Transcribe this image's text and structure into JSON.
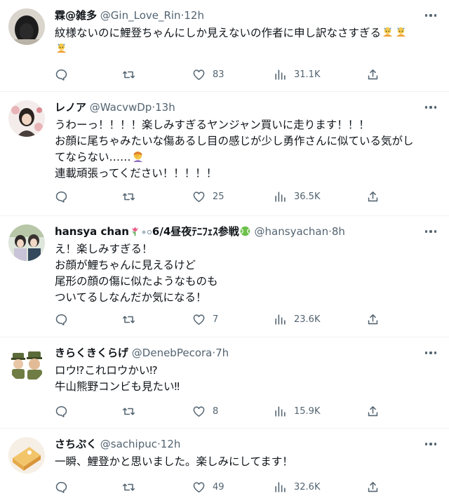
{
  "tweets": [
    {
      "name": "霖@雑多",
      "handle": "@Gin_Love_Rin",
      "time": "12h",
      "lines": [
        "紋様ないのに鯉登ちゃんにしか見えないの作者に申し訳なさすぎる"
      ],
      "replies": "",
      "retweets": "",
      "likes": "83",
      "views": "31.1K"
    },
    {
      "name": "レノア",
      "handle": "@WacvwDp",
      "time": "13h",
      "lines": [
        "うわーっ！！！！楽しみすぎるヤンジャン買いに走ります！！！",
        "お顔に尾ちゃみたいな傷あるし目の感じが少し勇作さんに似ている気がし",
        "てならない……",
        "連載頑張ってください！！！！！"
      ],
      "replies": "",
      "retweets": "",
      "likes": "25",
      "views": "36.5K"
    },
    {
      "name": "hansya chan",
      "name_suffix": "6/4昼夜ﾃﾆﾌｪｽ参戦",
      "handle": "@hansyachan",
      "time": "8h",
      "lines": [
        "え！楽しみすぎる！",
        "お顔が鯉ちゃんに見えるけど",
        "尾形の顔の傷に似たようなものも",
        "ついてるしなんだか気になる！"
      ],
      "replies": "",
      "retweets": "",
      "likes": "7",
      "views": "23.6K"
    },
    {
      "name": "きらくきくらげ",
      "handle": "@DenebPecora",
      "time": "7h",
      "lines": [
        "ロウ⁉これロウかい⁉",
        "牛山熊野コンビも見たい‼"
      ],
      "replies": "",
      "retweets": "",
      "likes": "8",
      "views": "15.9K"
    },
    {
      "name": "さちぷく",
      "handle": "@sachipuc",
      "time": "12h",
      "lines": [
        "一瞬、鯉登かと思いました。楽しみにしてます！"
      ],
      "replies": "",
      "retweets": "",
      "likes": "49",
      "views": "32.6K"
    }
  ],
  "separator": "·",
  "icons": {
    "reply": "reply-icon",
    "retweet": "retweet-icon",
    "like": "heart-icon",
    "views": "views-icon",
    "share": "share-icon",
    "more": "more-icon"
  },
  "colors": {
    "text": "#0f1419",
    "secondary": "#536471",
    "border": "#eff3f4",
    "verified_green": "#4caf50"
  }
}
